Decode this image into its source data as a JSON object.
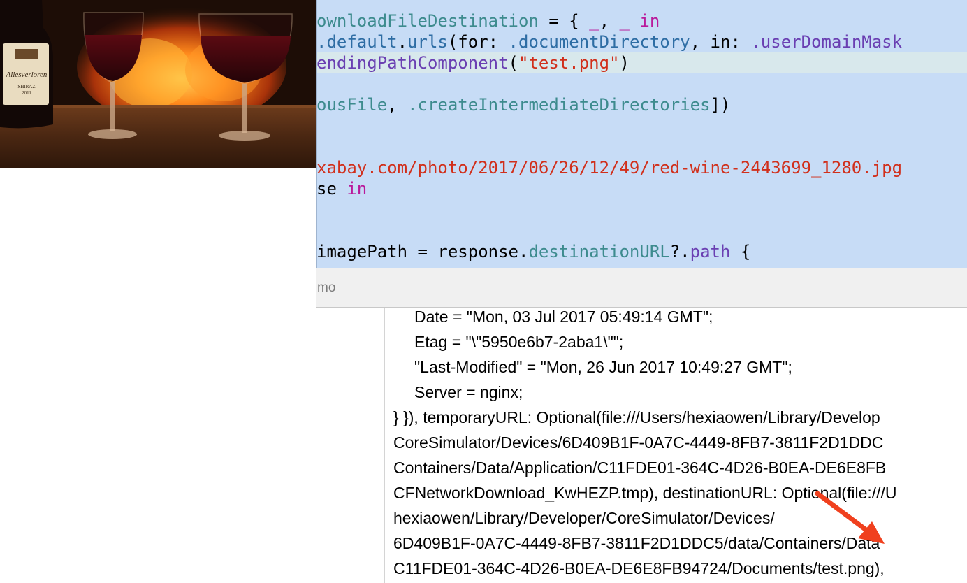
{
  "editor": {
    "lines": [
      [
        {
          "t": "ownloadFileDestination",
          "c": "tp"
        },
        {
          "t": " = { ",
          "c": "pl"
        },
        {
          "t": "_",
          "c": "kw"
        },
        {
          "t": ", ",
          "c": "pl"
        },
        {
          "t": "_",
          "c": "kw"
        },
        {
          "t": " ",
          "c": "pl"
        },
        {
          "t": "in",
          "c": "kw"
        }
      ],
      [
        {
          "t": ".default",
          "c": "fn"
        },
        {
          "t": ".",
          "c": "pl"
        },
        {
          "t": "urls",
          "c": "fn"
        },
        {
          "t": "(for: ",
          "c": "pl"
        },
        {
          "t": ".documentDirectory",
          "c": "fn"
        },
        {
          "t": ", in: ",
          "c": "pl"
        },
        {
          "t": ".userDomainMask",
          "c": "pr"
        }
      ],
      [
        {
          "t": "endingPathComponent",
          "c": "pr"
        },
        {
          "t": "(",
          "c": "pl"
        },
        {
          "t": "\"test.png\"",
          "c": "st"
        },
        {
          "t": ")",
          "c": "pl"
        }
      ],
      [],
      [
        {
          "t": "ousFile",
          "c": "tp"
        },
        {
          "t": ", ",
          "c": "pl"
        },
        {
          "t": ".createIntermediateDirectories",
          "c": "tp"
        },
        {
          "t": "])",
          "c": "pl"
        }
      ],
      [],
      [],
      [
        {
          "t": "xabay.com/photo/2017/06/26/12/49/red-wine-2443699_1280.jpg",
          "c": "st"
        }
      ],
      [
        {
          "t": "se ",
          "c": "pl"
        },
        {
          "t": "in",
          "c": "kw"
        }
      ],
      [],
      [],
      [
        {
          "t": "imagePath = response.",
          "c": "pl"
        },
        {
          "t": "destinationURL",
          "c": "tp"
        },
        {
          "t": "?.",
          "c": "pl"
        },
        {
          "t": "path",
          "c": "pr"
        },
        {
          "t": " {",
          "c": "pl"
        }
      ]
    ]
  },
  "debug_bar": {
    "label": "mo"
  },
  "console": {
    "lines": [
      "Date = \"Mon, 03 Jul 2017 05:49:14 GMT\";",
      "Etag = \"\\\"5950e6b7-2aba1\\\"\";",
      "\"Last-Modified\" = \"Mon, 26 Jun 2017 10:49:27 GMT\";",
      "Server = nginx;",
      "} }), temporaryURL: Optional(file:///Users/hexiaowen/Library/Develop",
      "CoreSimulator/Devices/6D409B1F-0A7C-4449-8FB7-3811F2D1DDC",
      "Containers/Data/Application/C11FDE01-364C-4D26-B0EA-DE6E8FB",
      "CFNetworkDownload_KwHEZP.tmp), destinationURL: Optional(file:///U",
      "hexiaowen/Library/Developer/CoreSimulator/Devices/",
      "6D409B1F-0A7C-4449-8FB7-3811F2D1DDC5/data/Containers/Data",
      "C11FDE01-364C-4D26-B0EA-DE6E8FB94724/Documents/test.png),"
    ],
    "indented_count": 4
  },
  "annotation": {
    "arrow_color": "#f0401e"
  },
  "colors": {
    "editor_bg": "#c7dcf6",
    "keyword": "#b91a9b",
    "string": "#d12f1b",
    "type": "#3d8b8e",
    "property": "#6a3fb2"
  }
}
